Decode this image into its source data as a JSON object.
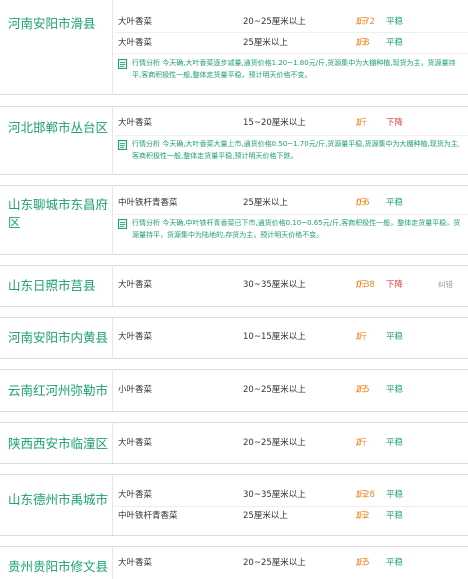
{
  "listings": [
    {
      "region": "河南安阳市滑县",
      "rows": [
        {
          "variety": "大叶香菜",
          "spec": "20~25厘米以上",
          "price": "1.72",
          "unit": "/斤",
          "trend": "平稳",
          "trend_color": "#1aa16c"
        },
        {
          "variety": "大叶香菜",
          "spec": "25厘米以上",
          "price": "1.8",
          "unit": "/斤",
          "trend": "平稳",
          "trend_color": "#1aa16c"
        }
      ],
      "analysis": "行情分析 今天确,大叶香菜逐步减量,通货价格1.20~1.80元/斤,货源集中为大棚种植,现货为主，货源量持平,客商积极性一般,整体走货量平稳，预计明天价格不变。"
    },
    {
      "region": "河北邯郸市丛台区",
      "rows": [
        {
          "variety": "大叶香菜",
          "spec": "15~20厘米以上",
          "price": "1",
          "unit": "/斤",
          "trend": "下降",
          "trend_color": "#e8413a"
        }
      ],
      "analysis": "行情分析 今天确,大叶香菜大量上市,通货价格0.50~1.70元/斤,货源量平稳,货源集中为大棚种植,现货为主,客商积极性一般,整体走货量平稳,预计明天价格下跌。"
    },
    {
      "region": "山东聊城市东昌府区",
      "rows": [
        {
          "variety": "中叶铁杆青香菜",
          "spec": "25厘米以上",
          "price": "0.6",
          "unit": "/斤",
          "trend": "平稳",
          "trend_color": "#1aa16c"
        }
      ],
      "analysis": "行情分析 今天确,中叶铁杆青香菜已下市,通货价格0.10~0.65元/斤,客商积极性一般，整体走货量平稳，货源量持平，货源集中为陆地的,存货为主，预计明天价格不变。"
    },
    {
      "region": "山东日照市莒县",
      "rows": [
        {
          "variety": "大叶香菜",
          "spec": "30~35厘米以上",
          "price": "0.38",
          "unit": "/斤",
          "trend": "下降",
          "trend_color": "#e8413a",
          "extra": "纠错"
        }
      ]
    },
    {
      "region": "河南安阳市内黄县",
      "rows": [
        {
          "variety": "大叶香菜",
          "spec": "10~15厘米以上",
          "price": "1",
          "unit": "/斤",
          "trend": "平稳",
          "trend_color": "#1aa16c"
        }
      ]
    },
    {
      "region": "云南红河州弥勒市",
      "rows": [
        {
          "variety": "小叶香菜",
          "spec": "20~25厘米以上",
          "price": "2.5",
          "unit": "/斤",
          "trend": "平稳",
          "trend_color": "#1aa16c"
        }
      ]
    },
    {
      "region": "陕西西安市临潼区",
      "rows": [
        {
          "variety": "大叶香菜",
          "spec": "20~25厘米以上",
          "price": "2",
          "unit": "/斤",
          "trend": "平稳",
          "trend_color": "#1aa16c"
        }
      ]
    },
    {
      "region": "山东德州市禹城市",
      "rows": [
        {
          "variety": "大叶香菜",
          "spec": "30~35厘米以上",
          "price": "1.28",
          "unit": "/斤",
          "trend": "平稳",
          "trend_color": "#1aa16c"
        },
        {
          "variety": "中叶铁杆青香菜",
          "spec": "25厘米以上",
          "price": "1.2",
          "unit": "/斤",
          "trend": "平稳",
          "trend_color": "#1aa16c"
        }
      ]
    },
    {
      "region": "贵州贵阳市修文县",
      "rows": [
        {
          "variety": "大叶香菜",
          "spec": "20~25厘米以上",
          "price": "1.5",
          "unit": "/斤",
          "trend": "平稳",
          "trend_color": "#1aa16c"
        }
      ]
    }
  ]
}
